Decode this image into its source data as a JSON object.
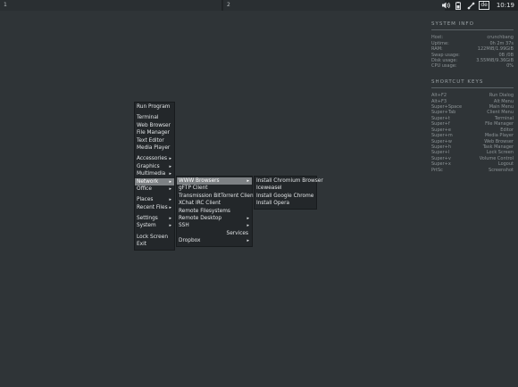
{
  "panel": {
    "workspace_1": "1",
    "workspace_2": "2",
    "keyboard_layout": "de",
    "clock": "10:19",
    "icons": [
      "volume-icon",
      "battery-icon",
      "network-icon"
    ]
  },
  "conky": {
    "system_title": "SYSTEM INFO",
    "system_rows": [
      {
        "label": "Host:",
        "value": "crunchbang"
      },
      {
        "label": "Uptime:",
        "value": "0h 2m 37s"
      },
      {
        "label": "RAM:",
        "value": "122MiB/1.99GiB"
      },
      {
        "label": "Swap usage:",
        "value": "0B /0B"
      },
      {
        "label": "Disk usage:",
        "value": "3.55MiB/9.36GiB"
      },
      {
        "label": "CPU usage:",
        "value": "0%"
      }
    ],
    "shortcut_title": "SHORTCUT KEYS",
    "shortcut_rows": [
      {
        "label": "Alt+F2",
        "value": "Run Dialog"
      },
      {
        "label": "Alt+F3",
        "value": "Alt Menu"
      },
      {
        "label": "Super+Space",
        "value": "Main Menu"
      },
      {
        "label": "Super+Tab",
        "value": "Client Menu"
      },
      {
        "label": "Super+t",
        "value": "Terminal"
      },
      {
        "label": "Super+f",
        "value": "File Manager"
      },
      {
        "label": "Super+e",
        "value": "Editor"
      },
      {
        "label": "Super+m",
        "value": "Media Player"
      },
      {
        "label": "Super+w",
        "value": "Web Browser"
      },
      {
        "label": "Super+h",
        "value": "Task Manager"
      },
      {
        "label": "Super+l",
        "value": "Lock Screen"
      },
      {
        "label": "Super+v",
        "value": "Volume Control"
      },
      {
        "label": "Super+x",
        "value": "Logout"
      },
      {
        "label": "PrtSc",
        "value": "Screenshot"
      }
    ]
  },
  "main_menu": {
    "groups": [
      [
        {
          "label": "Run Program",
          "submenu": false
        }
      ],
      [
        {
          "label": "Terminal",
          "submenu": false
        },
        {
          "label": "Web Browser",
          "submenu": false
        },
        {
          "label": "File Manager",
          "submenu": false
        },
        {
          "label": "Text Editor",
          "submenu": false
        },
        {
          "label": "Media Player",
          "submenu": false
        }
      ],
      [
        {
          "label": "Accessories",
          "submenu": true
        },
        {
          "label": "Graphics",
          "submenu": true
        },
        {
          "label": "Multimedia",
          "submenu": true
        },
        {
          "label": "Network",
          "submenu": true,
          "selected": true
        },
        {
          "label": "Office",
          "submenu": true
        }
      ],
      [
        {
          "label": "Places",
          "submenu": true
        },
        {
          "label": "Recent Files",
          "submenu": true
        }
      ],
      [
        {
          "label": "Settings",
          "submenu": true
        },
        {
          "label": "System",
          "submenu": true
        }
      ],
      [
        {
          "label": "Lock Screen",
          "submenu": false
        },
        {
          "label": "Exit",
          "submenu": false
        }
      ]
    ]
  },
  "network_menu": {
    "items": [
      {
        "label": "WWW Browsers",
        "submenu": true,
        "selected": true
      },
      {
        "label": "gFTP Client",
        "submenu": false
      },
      {
        "label": "Transmission BitTorrent Client",
        "submenu": false
      },
      {
        "label": "XChat IRC Client",
        "submenu": false
      },
      {
        "label": "Remote Filesystems",
        "submenu": false
      },
      {
        "label": "Remote Desktop",
        "submenu": true
      },
      {
        "label": "SSH",
        "submenu": true
      },
      {
        "label": "Services",
        "submenu": false,
        "align": "right"
      },
      {
        "label": "Dropbox",
        "submenu": true
      }
    ]
  },
  "browsers_menu": {
    "items": [
      {
        "label": "Install Chromium Browser"
      },
      {
        "label": "Iceweasel"
      },
      {
        "label": "Install Google Chrome"
      },
      {
        "label": "Install Opera"
      }
    ]
  },
  "colors": {
    "desktop": "#2f3437",
    "menu_bg": "#23272a",
    "selection": "#7d8184"
  }
}
